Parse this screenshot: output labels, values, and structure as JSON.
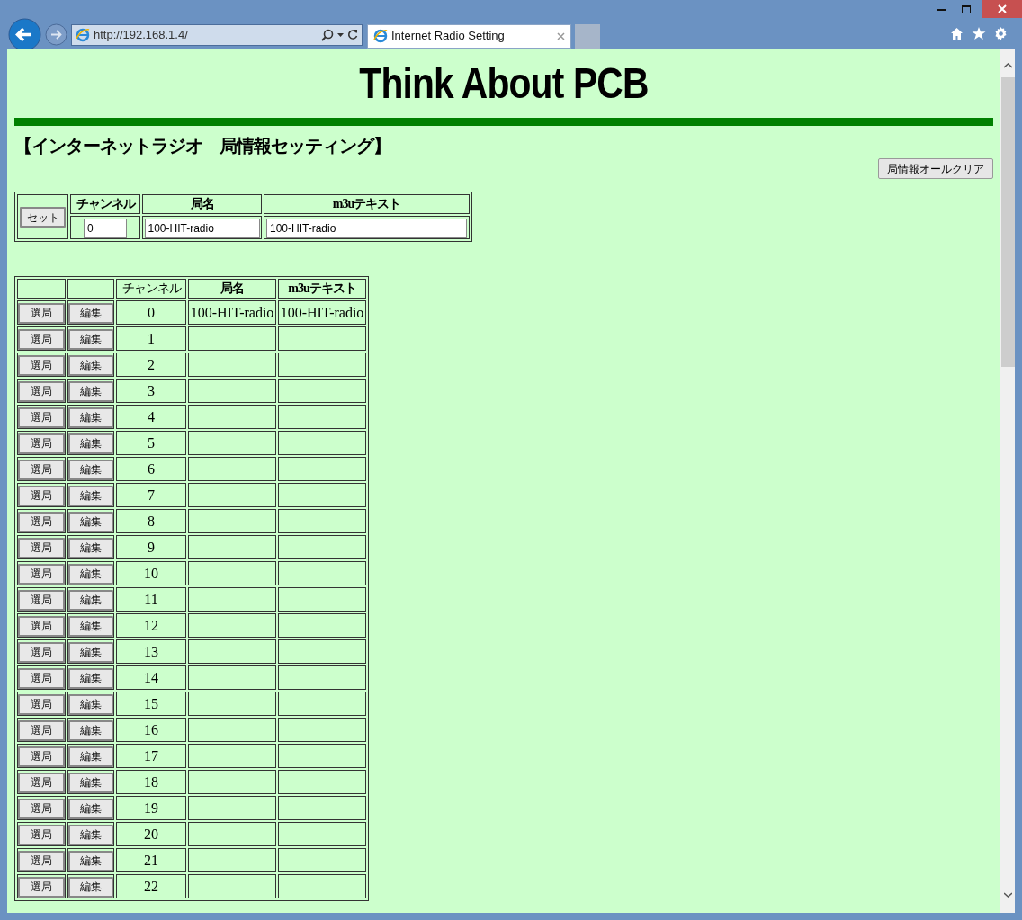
{
  "browser": {
    "address": "http://192.168.1.4/",
    "tabs": [
      {
        "title": "Internet Radio Setting",
        "selected": true
      }
    ]
  },
  "page": {
    "site_title": "Think About PCB",
    "heading": "【インターネットラジオ　局情報セッティング】",
    "clear_all_button": "局情報オールクリア",
    "edit_form": {
      "set_button": "セット",
      "columns": [
        "チャンネル",
        "局名",
        "m3uテキスト"
      ],
      "channel_value": "0",
      "name_value": "100-HIT-radio",
      "m3u_value": "100-HIT-radio"
    },
    "station_table": {
      "columns": [
        "チャンネル",
        "局名",
        "m3uテキスト"
      ],
      "rows": [
        {
          "select_button": "選局",
          "edit_button": "編集",
          "channel": "0",
          "name": "100-HIT-radio",
          "m3u": "100-HIT-radio"
        },
        {
          "select_button": "選局",
          "edit_button": "編集",
          "channel": "1"
        },
        {
          "select_button": "選局",
          "edit_button": "編集",
          "channel": "2"
        },
        {
          "select_button": "選局",
          "edit_button": "編集",
          "channel": "3"
        },
        {
          "select_button": "選局",
          "edit_button": "編集",
          "channel": "4"
        },
        {
          "select_button": "選局",
          "edit_button": "編集",
          "channel": "5"
        },
        {
          "select_button": "選局",
          "edit_button": "編集",
          "channel": "6"
        },
        {
          "select_button": "選局",
          "edit_button": "編集",
          "channel": "7"
        },
        {
          "select_button": "選局",
          "edit_button": "編集",
          "channel": "8"
        },
        {
          "select_button": "選局",
          "edit_button": "編集",
          "channel": "9"
        },
        {
          "select_button": "選局",
          "edit_button": "編集",
          "channel": "10"
        },
        {
          "select_button": "選局",
          "edit_button": "編集",
          "channel": "11"
        },
        {
          "select_button": "選局",
          "edit_button": "編集",
          "channel": "12"
        },
        {
          "select_button": "選局",
          "edit_button": "編集",
          "channel": "13"
        },
        {
          "select_button": "選局",
          "edit_button": "編集",
          "channel": "14"
        },
        {
          "select_button": "選局",
          "edit_button": "編集",
          "channel": "15"
        },
        {
          "select_button": "選局",
          "edit_button": "編集",
          "channel": "16"
        },
        {
          "select_button": "選局",
          "edit_button": "編集",
          "channel": "17"
        },
        {
          "select_button": "選局",
          "edit_button": "編集",
          "channel": "18"
        },
        {
          "select_button": "選局",
          "edit_button": "編集",
          "channel": "19"
        },
        {
          "select_button": "選局",
          "edit_button": "編集",
          "channel": "20"
        },
        {
          "select_button": "選局",
          "edit_button": "編集",
          "channel": "21"
        },
        {
          "select_button": "選局",
          "edit_button": "編集",
          "channel": "22"
        }
      ]
    }
  }
}
